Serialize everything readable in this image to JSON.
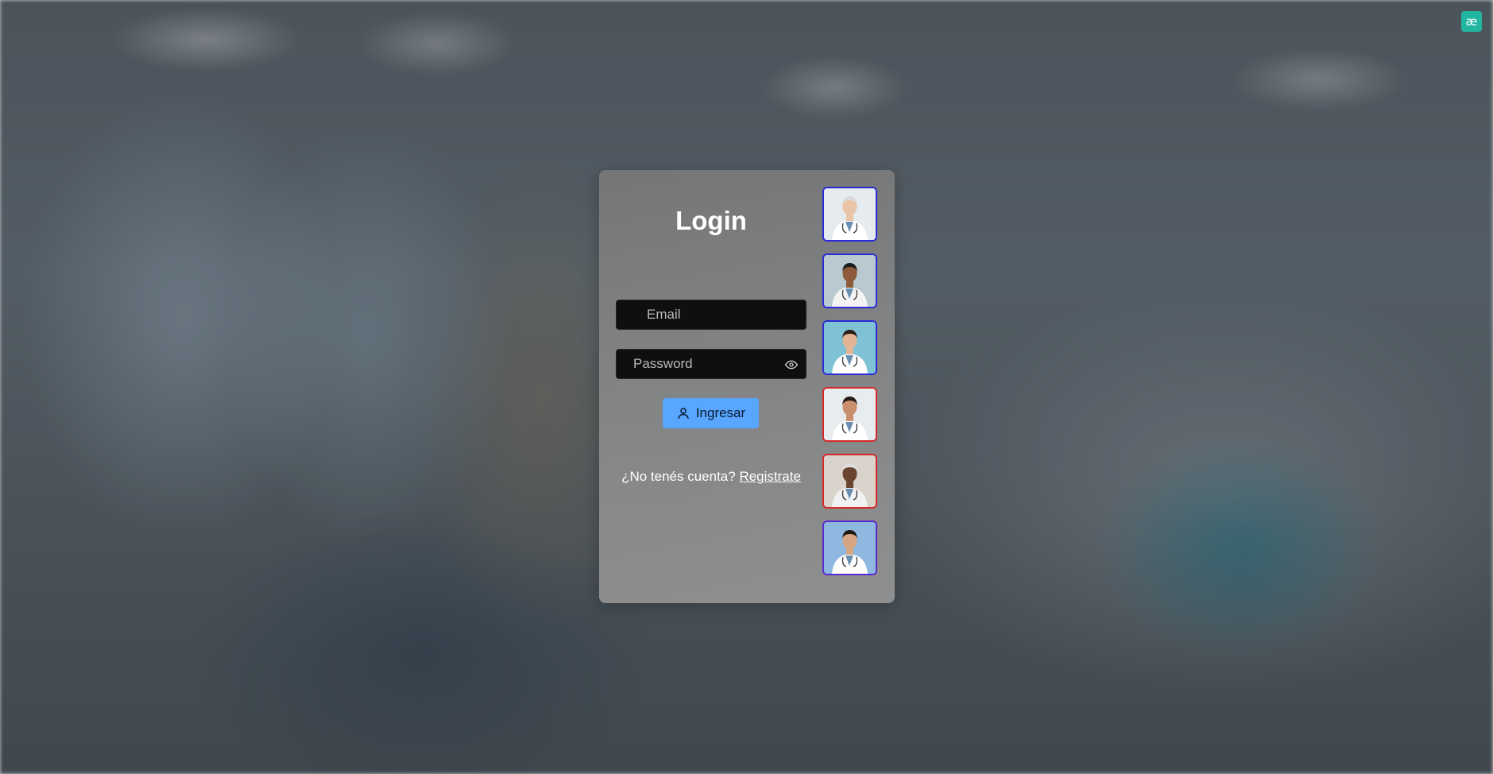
{
  "login": {
    "title": "Login",
    "email_placeholder": "Email",
    "password_placeholder": "Password",
    "submit_label": "Ingresar",
    "register_prompt": "¿No tenés cuenta?",
    "register_link": "Registrate"
  },
  "avatars": [
    {
      "border": "#2a2ad8",
      "bg": "#e6ebf0",
      "skin": "#e9c4a6",
      "hair": "#d9d9d9",
      "coat": "#ffffff"
    },
    {
      "border": "#2a2ad8",
      "bg": "#b9c9cf",
      "skin": "#8d5a3b",
      "hair": "#1c1c1c",
      "coat": "#f4f4f4"
    },
    {
      "border": "#2a2ad8",
      "bg": "#7fc2d6",
      "skin": "#e2b596",
      "hair": "#2b1d14",
      "coat": "#ffffff"
    },
    {
      "border": "#d62828",
      "bg": "#e7ecef",
      "skin": "#c98f6c",
      "hair": "#241a14",
      "coat": "#ffffff"
    },
    {
      "border": "#d62828",
      "bg": "#d9d3cb",
      "skin": "#6b4430",
      "hair": "#dedede",
      "coat": "#f1f1f1"
    },
    {
      "border": "#5a2ad0",
      "bg": "#8fb8e0",
      "skin": "#d6a582",
      "hair": "#1f1712",
      "coat": "#ffffff"
    }
  ],
  "colors": {
    "accent_button": "#58a6ff",
    "brand_badge": "#22b5a0"
  }
}
